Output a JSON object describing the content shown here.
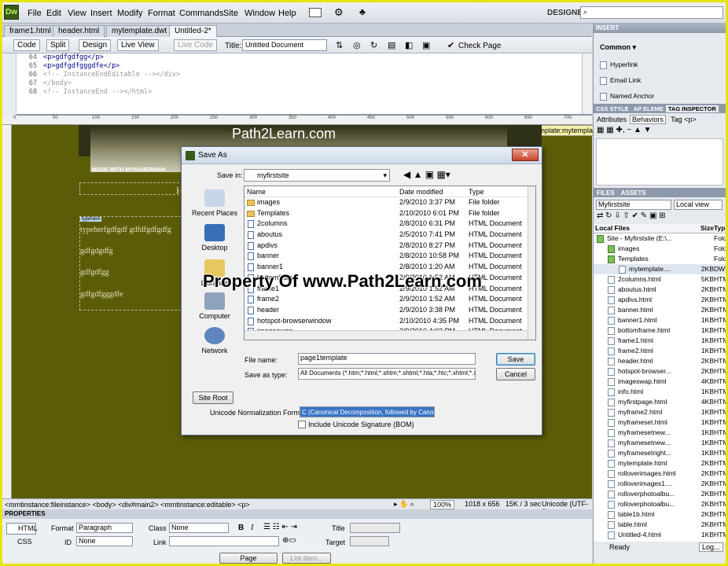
{
  "app": {
    "logo": "Dw",
    "menus": [
      "File",
      "Edit",
      "View",
      "Insert",
      "Modify",
      "Format",
      "Commands",
      "Site",
      "Window",
      "Help"
    ],
    "workspace": "DESIGNER"
  },
  "tabs": [
    "frame1.html",
    "header.html",
    "mytemplate.dwt",
    "Untitled-2*"
  ],
  "doc_toolbar": {
    "code": "Code",
    "split": "Split",
    "design": "Design",
    "live_view": "Live View",
    "live_code": "Live Code",
    "title_label": "Title:",
    "title_value": "Untitled Document",
    "check_page": "Check Page"
  },
  "code_lines": [
    {
      "n": "64",
      "t": "<p>gdfgdfgg</p>"
    },
    {
      "n": "65",
      "t": "<p>gdfgdfgggdfe</p>"
    },
    {
      "n": "66",
      "t": "<!-- InstanceEndEditable --></div>"
    },
    {
      "n": "67",
      "t": "</body>"
    },
    {
      "n": "68",
      "t": "<!-- InstanceEnd --></html>"
    }
  ],
  "ruler_ticks": [
    "0",
    "50",
    "100",
    "150",
    "200",
    "250",
    "300",
    "350",
    "400",
    "450",
    "500",
    "550",
    "600",
    "650",
    "700"
  ],
  "design": {
    "site_title": "Path2Learn.com",
    "made_with": "MADE WITH MYRAHERMAK",
    "template_tag": "Template:mytemplate",
    "region_tag": "typehere",
    "para1": "typeherfgdfgdf gdfdfgdfgdfg",
    "para2": "gdfgdgdfg",
    "para3": "gdfgdfgg",
    "para4": "gdfgdfgggdfe",
    "heading_letter": "H"
  },
  "status": {
    "tags": "<mmtinstance:fileinstance> <body> <div#main2> <mmtinstance:editable> <p>",
    "zoom": "100%",
    "size": "1018 x 656",
    "weight": "15K / 3 sec",
    "encoding": "Unicode (UTF-8)"
  },
  "properties": {
    "header": "PROPERTIES",
    "html_btn": "HTML",
    "css_btn": "CSS",
    "format_label": "Format",
    "format_value": "Paragraph",
    "class_label": "Class",
    "class_value": "None",
    "id_label": "ID",
    "id_value": "None",
    "link_label": "Link",
    "title_label": "Title",
    "target_label": "Target",
    "page_props": "Page Properties...",
    "list_item": "List Item..."
  },
  "insert_panel": {
    "header": "INSERT",
    "category": "Common",
    "items": [
      "Hyperlink",
      "Email Link",
      "Named Anchor"
    ]
  },
  "css_panel": {
    "tabs": [
      "CSS STYLE",
      "AP ELEME",
      "TAG INSPECTOR"
    ],
    "subtabs": [
      "Attributes",
      "Behaviors"
    ],
    "tag": "Tag <p>"
  },
  "files_panel": {
    "tabs": [
      "FILES",
      "ASSETS"
    ],
    "site": "Myfirstsite",
    "view": "Local view",
    "col_files": "Local Files",
    "col_size": "Size",
    "col_type": "Typ",
    "rows": [
      {
        "name": "Site - Myfirstsite (E:\\...",
        "size": "",
        "type": "Folde",
        "indent": 0,
        "kind": "site"
      },
      {
        "name": "images",
        "size": "",
        "type": "Folde",
        "indent": 1,
        "kind": "folder"
      },
      {
        "name": "Templates",
        "size": "",
        "type": "Folde",
        "indent": 1,
        "kind": "folder"
      },
      {
        "name": "mytemplate....",
        "size": "2KB",
        "type": "DWT",
        "indent": 2,
        "kind": "file"
      },
      {
        "name": "2columns.html",
        "size": "5KB",
        "type": "HTM",
        "indent": 1,
        "kind": "file"
      },
      {
        "name": "aboutus.html",
        "size": "2KB",
        "type": "HTM",
        "indent": 1,
        "kind": "file"
      },
      {
        "name": "apdivs.html",
        "size": "2KB",
        "type": "HTM",
        "indent": 1,
        "kind": "file"
      },
      {
        "name": "banner.html",
        "size": "2KB",
        "type": "HTM",
        "indent": 1,
        "kind": "file"
      },
      {
        "name": "banner1.html",
        "size": "1KB",
        "type": "HTM",
        "indent": 1,
        "kind": "file"
      },
      {
        "name": "bottomframe.html",
        "size": "1KB",
        "type": "HTM",
        "indent": 1,
        "kind": "file"
      },
      {
        "name": "frame1.html",
        "size": "1KB",
        "type": "HTM",
        "indent": 1,
        "kind": "file"
      },
      {
        "name": "frame2.html",
        "size": "1KB",
        "type": "HTM",
        "indent": 1,
        "kind": "file"
      },
      {
        "name": "header.html",
        "size": "2KB",
        "type": "HTM",
        "indent": 1,
        "kind": "file"
      },
      {
        "name": "hotspot-browser...",
        "size": "2KB",
        "type": "HTM",
        "indent": 1,
        "kind": "file"
      },
      {
        "name": "imageswap.html",
        "size": "4KB",
        "type": "HTM",
        "indent": 1,
        "kind": "file"
      },
      {
        "name": "info.html",
        "size": "1KB",
        "type": "HTM",
        "indent": 1,
        "kind": "file"
      },
      {
        "name": "myfirstpage.html",
        "size": "4KB",
        "type": "HTM",
        "indent": 1,
        "kind": "file"
      },
      {
        "name": "myframe2.html",
        "size": "1KB",
        "type": "HTM",
        "indent": 1,
        "kind": "file"
      },
      {
        "name": "myframeset.html",
        "size": "1KB",
        "type": "HTM",
        "indent": 1,
        "kind": "file"
      },
      {
        "name": "myframesetnew...",
        "size": "1KB",
        "type": "HTM",
        "indent": 1,
        "kind": "file"
      },
      {
        "name": "myframesetnew...",
        "size": "1KB",
        "type": "HTM",
        "indent": 1,
        "kind": "file"
      },
      {
        "name": "myframesetright...",
        "size": "1KB",
        "type": "HTM",
        "indent": 1,
        "kind": "file"
      },
      {
        "name": "mytemplate.html",
        "size": "2KB",
        "type": "HTM",
        "indent": 1,
        "kind": "file"
      },
      {
        "name": "rolloverimages.html",
        "size": "2KB",
        "type": "HTM",
        "indent": 1,
        "kind": "file"
      },
      {
        "name": "rolloverimages1....",
        "size": "2KB",
        "type": "HTM",
        "indent": 1,
        "kind": "file"
      },
      {
        "name": "rolloverphotoalbu...",
        "size": "2KB",
        "type": "HTM",
        "indent": 1,
        "kind": "file"
      },
      {
        "name": "rolloverphotoalbu...",
        "size": "2KB",
        "type": "HTM",
        "indent": 1,
        "kind": "file"
      },
      {
        "name": "table1b.html",
        "size": "2KB",
        "type": "HTM",
        "indent": 1,
        "kind": "file"
      },
      {
        "name": "table.html",
        "size": "2KB",
        "type": "HTM",
        "indent": 1,
        "kind": "file"
      },
      {
        "name": "Untitled-4.html",
        "size": "1KB",
        "type": "HTM",
        "indent": 1,
        "kind": "file"
      }
    ],
    "status": "Ready",
    "log": "Log..."
  },
  "dialog": {
    "title": "Save As",
    "save_in_label": "Save in:",
    "save_in_value": "myfirstsite",
    "places": [
      "Recent Places",
      "Desktop",
      "Libraries",
      "Computer",
      "Network"
    ],
    "col_name": "Name",
    "col_date": "Date modified",
    "col_type": "Type",
    "files": [
      {
        "name": "images",
        "date": "2/9/2010 3:37 PM",
        "type": "File folder",
        "kind": "folder"
      },
      {
        "name": "Templates",
        "date": "2/10/2010 6:01 PM",
        "type": "File folder",
        "kind": "folder"
      },
      {
        "name": "2columns",
        "date": "2/8/2010 6:31 PM",
        "type": "HTML Document",
        "kind": "doc"
      },
      {
        "name": "aboutus",
        "date": "2/5/2010 7:41 PM",
        "type": "HTML Document",
        "kind": "doc"
      },
      {
        "name": "apdivs",
        "date": "2/8/2010 8:27 PM",
        "type": "HTML Document",
        "kind": "doc"
      },
      {
        "name": "banner",
        "date": "2/8/2010 10:58 PM",
        "type": "HTML Document",
        "kind": "doc"
      },
      {
        "name": "banner1",
        "date": "2/8/2010 1:20 AM",
        "type": "HTML Document",
        "kind": "doc"
      },
      {
        "name": "bottomframe",
        "date": "2/9/2010 1:52 AM",
        "type": "HTML Document",
        "kind": "doc"
      },
      {
        "name": "frame1",
        "date": "2/9/2010 1:52 AM",
        "type": "HTML Document",
        "kind": "doc"
      },
      {
        "name": "frame2",
        "date": "2/9/2010 1:52 AM",
        "type": "HTML Document",
        "kind": "doc"
      },
      {
        "name": "header",
        "date": "2/9/2010 3:38 PM",
        "type": "HTML Document",
        "kind": "doc"
      },
      {
        "name": "hotspot-browserwindow",
        "date": "2/10/2010 4:35 PM",
        "type": "HTML Document",
        "kind": "doc"
      },
      {
        "name": "imageswap",
        "date": "2/9/2010 4:02 PM",
        "type": "HTML Document",
        "kind": "doc"
      }
    ],
    "file_name_label": "File name:",
    "file_name_value": "page1template",
    "save_type_label": "Save as type:",
    "save_type_value": "All Documents (*.htm;*.html;*.shtm;*.shtml;*.hta;*.htc;*.xhtml;*.stm;*.ssi;*.js;*.json;*.as;*.asc;*.asr;*.xml;*.xsl;*.xsd;*.dtd;*.xslt;*.rss;*.rdf;*.lbi;*.dwt;*.asp;*.asa;*.aspx;*.ascx;*.asmx;*.config;*.cs;*.css;*.cfm;*.cfml;*.cfc;*.tld;*.txt;*.php;*.php3;*.php4;*.php5;*.lasso;*.jsp;*.jst;*.tpl;*.tag;*.lib;*.json;*.dat)",
    "save_btn": "Save",
    "cancel_btn": "Cancel",
    "site_root": "Site Root",
    "unicode_label": "Unicode Normalization Form:",
    "unicode_value": "C (Canonical Decomposition, followed by Canonical Composition)",
    "bom_label": "Include Unicode Signature (BOM)"
  },
  "watermark": "Property Of www.Path2Learn.com"
}
